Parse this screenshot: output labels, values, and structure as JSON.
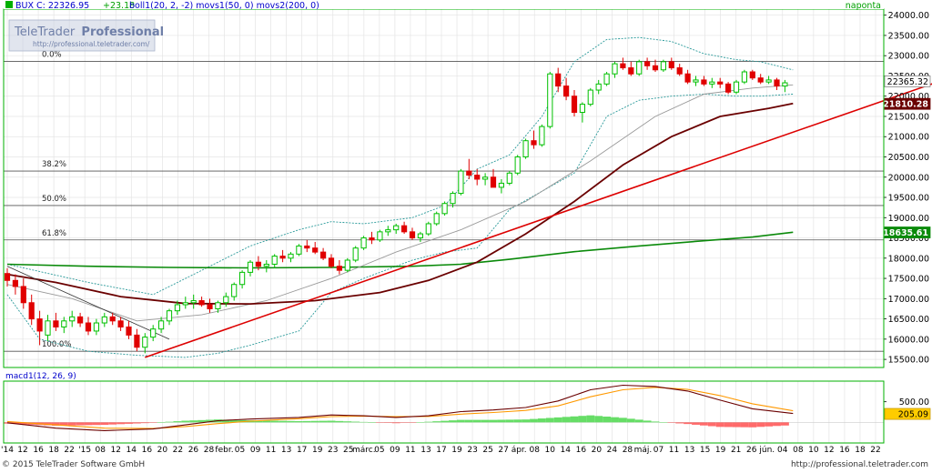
{
  "header": {
    "instrument": "BUX C: 22326.95",
    "change": "+23.18",
    "indicators": "boll1(20, 2, -2) movs1(50, 0) movs2(200, 0)",
    "period": "naponta"
  },
  "watermark": {
    "brand_part1": "TeleTrader",
    "brand_part2": "Professional",
    "url": "http://professional.teletrader.com/"
  },
  "macd_header": "macd1(12, 26, 9)",
  "footer": {
    "copyright": "© 2015 TeleTrader Software GmbH",
    "url": "http://professional.teletrader.com"
  },
  "colors": {
    "background": "#ffffff",
    "panel_border": "#00b000",
    "header_text": "#0000cc",
    "change_text": "#00a000",
    "grid": "#e4e4e4",
    "candle_up": "#00c000",
    "candle_down": "#e00000",
    "bollinger": "#2a9a9a",
    "ma50": "#999999",
    "ma200": "#6a0000",
    "green_ma": "#0a8a0a",
    "trendline": "#dd0000",
    "macd_line": "#6a0000",
    "signal_line": "#ff9900",
    "hist_pos": "#66dd66",
    "hist_neg": "#ff6a6a"
  },
  "chart_data": {
    "type": "line",
    "title": "BUX",
    "period": "naponta",
    "ylim": [
      15300,
      24150
    ],
    "y_ticks": [
      "24000.00",
      "23500.00",
      "23000.00",
      "22500.00",
      "22000.00",
      "21500.00",
      "21000.00",
      "20500.00",
      "20000.00",
      "19500.00",
      "19000.00",
      "18500.00",
      "18000.00",
      "17500.00",
      "17000.00",
      "16500.00",
      "16000.00",
      "15500.00"
    ],
    "x_ticks": [
      "'14",
      "12",
      "16",
      "18",
      "22",
      "'15",
      "08",
      "12",
      "14",
      "16",
      "20",
      "22",
      "26",
      "28",
      "febr.",
      "05",
      "09",
      "11",
      "13",
      "17",
      "19",
      "23",
      "25",
      "márc.",
      "05",
      "09",
      "11",
      "13",
      "17",
      "19",
      "23",
      "25",
      "27",
      "ápr.",
      "08",
      "10",
      "14",
      "16",
      "20",
      "24",
      "28",
      "máj.",
      "07",
      "11",
      "13",
      "15",
      "19",
      "21",
      "26",
      "jún.",
      "04",
      "08",
      "10",
      "12",
      "16",
      "18",
      "22"
    ],
    "fibonacci": [
      {
        "label": "0.0%",
        "value": 22860
      },
      {
        "label": "38.2%",
        "value": 20150
      },
      {
        "label": "50.0%",
        "value": 19300
      },
      {
        "label": "61.8%",
        "value": 18450
      },
      {
        "label": "100.0%",
        "value": 15700
      }
    ],
    "price_labels": [
      {
        "text": "22365.32",
        "value": 22365
      },
      {
        "text": "21810.28",
        "value": 21810
      },
      {
        "text": "18635.61",
        "value": 18635
      }
    ],
    "ohlc": [
      [
        17620,
        17750,
        17300,
        17450
      ],
      [
        17450,
        17600,
        17100,
        17300
      ],
      [
        17300,
        17500,
        16750,
        16900
      ],
      [
        16900,
        17100,
        16350,
        16500
      ],
      [
        16500,
        16700,
        15850,
        16200
      ],
      [
        16100,
        16600,
        15950,
        16450
      ],
      [
        16450,
        16650,
        16200,
        16300
      ],
      [
        16300,
        16550,
        16150,
        16450
      ],
      [
        16450,
        16700,
        16300,
        16550
      ],
      [
        16550,
        16650,
        16300,
        16400
      ],
      [
        16400,
        16550,
        16100,
        16200
      ],
      [
        16200,
        16500,
        16100,
        16400
      ],
      [
        16400,
        16650,
        16300,
        16550
      ],
      [
        16550,
        16650,
        16350,
        16450
      ],
      [
        16450,
        16550,
        16200,
        16300
      ],
      [
        16300,
        16450,
        16000,
        16100
      ],
      [
        16100,
        16250,
        15700,
        15800
      ],
      [
        15800,
        16150,
        15650,
        16050
      ],
      [
        16050,
        16350,
        15950,
        16250
      ],
      [
        16250,
        16550,
        16150,
        16450
      ],
      [
        16450,
        16750,
        16350,
        16700
      ],
      [
        16700,
        16950,
        16600,
        16850
      ],
      [
        16850,
        17050,
        16750,
        16900
      ],
      [
        16900,
        17100,
        16750,
        16950
      ],
      [
        16950,
        17050,
        16800,
        16850
      ],
      [
        16850,
        17000,
        16650,
        16750
      ],
      [
        16750,
        16950,
        16650,
        16900
      ],
      [
        16900,
        17150,
        16800,
        17050
      ],
      [
        17050,
        17400,
        16950,
        17350
      ],
      [
        17350,
        17700,
        17250,
        17650
      ],
      [
        17650,
        17950,
        17550,
        17900
      ],
      [
        17900,
        18050,
        17700,
        17800
      ],
      [
        17800,
        17950,
        17650,
        17850
      ],
      [
        17850,
        18100,
        17750,
        18050
      ],
      [
        18050,
        18200,
        17900,
        18000
      ],
      [
        18000,
        18150,
        17900,
        18100
      ],
      [
        18100,
        18350,
        18050,
        18300
      ],
      [
        18300,
        18450,
        18150,
        18250
      ],
      [
        18250,
        18400,
        18100,
        18150
      ],
      [
        18150,
        18250,
        17950,
        18000
      ],
      [
        18000,
        18100,
        17750,
        17800
      ],
      [
        17800,
        17950,
        17600,
        17700
      ],
      [
        17700,
        18000,
        17650,
        17950
      ],
      [
        17950,
        18300,
        17900,
        18250
      ],
      [
        18250,
        18550,
        18200,
        18500
      ],
      [
        18500,
        18650,
        18350,
        18450
      ],
      [
        18450,
        18700,
        18400,
        18650
      ],
      [
        18650,
        18800,
        18550,
        18700
      ],
      [
        18700,
        18850,
        18600,
        18800
      ],
      [
        18800,
        18900,
        18600,
        18650
      ],
      [
        18650,
        18750,
        18450,
        18500
      ],
      [
        18500,
        18650,
        18400,
        18600
      ],
      [
        18600,
        18900,
        18550,
        18850
      ],
      [
        18850,
        19150,
        18800,
        19100
      ],
      [
        19100,
        19400,
        19050,
        19350
      ],
      [
        19350,
        19650,
        19250,
        19600
      ],
      [
        19600,
        20200,
        19550,
        20150
      ],
      [
        20150,
        20450,
        19950,
        20050
      ],
      [
        20050,
        20200,
        19800,
        19950
      ],
      [
        19950,
        20100,
        19800,
        20000
      ],
      [
        20000,
        20200,
        19850,
        19750
      ],
      [
        19750,
        19950,
        19600,
        19850
      ],
      [
        19850,
        20150,
        19800,
        20100
      ],
      [
        20100,
        20550,
        20050,
        20500
      ],
      [
        20500,
        20950,
        20450,
        20900
      ],
      [
        20900,
        21150,
        20700,
        20800
      ],
      [
        20800,
        21300,
        20750,
        21250
      ],
      [
        21250,
        22600,
        21200,
        22550
      ],
      [
        22550,
        22700,
        22100,
        22250
      ],
      [
        22250,
        22450,
        21900,
        22000
      ],
      [
        22000,
        22150,
        21500,
        21600
      ],
      [
        21600,
        21850,
        21350,
        21800
      ],
      [
        21800,
        22200,
        21750,
        22150
      ],
      [
        22150,
        22400,
        22050,
        22300
      ],
      [
        22300,
        22600,
        22250,
        22550
      ],
      [
        22550,
        22850,
        22450,
        22800
      ],
      [
        22800,
        22950,
        22650,
        22700
      ],
      [
        22700,
        22850,
        22500,
        22550
      ],
      [
        22550,
        22900,
        22500,
        22850
      ],
      [
        22850,
        22950,
        22650,
        22750
      ],
      [
        22750,
        22900,
        22600,
        22650
      ],
      [
        22650,
        22900,
        22600,
        22850
      ],
      [
        22850,
        22950,
        22650,
        22700
      ],
      [
        22700,
        22800,
        22500,
        22550
      ],
      [
        22550,
        22650,
        22300,
        22350
      ],
      [
        22350,
        22500,
        22250,
        22400
      ],
      [
        22400,
        22500,
        22250,
        22300
      ],
      [
        22300,
        22450,
        22200,
        22350
      ],
      [
        22350,
        22450,
        22200,
        22300
      ],
      [
        22300,
        22350,
        22050,
        22100
      ],
      [
        22100,
        22400,
        22050,
        22350
      ],
      [
        22350,
        22650,
        22300,
        22600
      ],
      [
        22600,
        22650,
        22400,
        22450
      ],
      [
        22450,
        22550,
        22300,
        22350
      ],
      [
        22350,
        22500,
        22300,
        22400
      ],
      [
        22400,
        22450,
        22150,
        22250
      ],
      [
        22250,
        22400,
        22100,
        22330
      ]
    ],
    "bollinger_upper": [
      [
        0,
        17850
      ],
      [
        10,
        17400
      ],
      [
        18,
        17100
      ],
      [
        24,
        17700
      ],
      [
        30,
        18300
      ],
      [
        36,
        18700
      ],
      [
        40,
        18900
      ],
      [
        44,
        18850
      ],
      [
        50,
        19000
      ],
      [
        54,
        19300
      ],
      [
        58,
        20200
      ],
      [
        62,
        20550
      ],
      [
        66,
        21500
      ],
      [
        70,
        22850
      ],
      [
        74,
        23400
      ],
      [
        78,
        23450
      ],
      [
        82,
        23350
      ],
      [
        86,
        23050
      ],
      [
        90,
        22900
      ],
      [
        93,
        22850
      ],
      [
        97,
        22650
      ]
    ],
    "bollinger_lower": [
      [
        0,
        17100
      ],
      [
        4,
        16000
      ],
      [
        10,
        15700
      ],
      [
        16,
        15600
      ],
      [
        22,
        15550
      ],
      [
        26,
        15650
      ],
      [
        30,
        15850
      ],
      [
        36,
        16200
      ],
      [
        40,
        17150
      ],
      [
        44,
        17500
      ],
      [
        50,
        17950
      ],
      [
        54,
        18150
      ],
      [
        58,
        18250
      ],
      [
        62,
        19200
      ],
      [
        66,
        19650
      ],
      [
        70,
        20100
      ],
      [
        74,
        21500
      ],
      [
        78,
        21900
      ],
      [
        82,
        22000
      ],
      [
        86,
        22050
      ],
      [
        90,
        22000
      ],
      [
        93,
        22000
      ],
      [
        97,
        22050
      ]
    ],
    "ma50": [
      [
        0,
        17350
      ],
      [
        8,
        17000
      ],
      [
        16,
        16450
      ],
      [
        24,
        16600
      ],
      [
        32,
        16950
      ],
      [
        40,
        17500
      ],
      [
        48,
        18150
      ],
      [
        56,
        18700
      ],
      [
        64,
        19400
      ],
      [
        72,
        20400
      ],
      [
        80,
        21500
      ],
      [
        86,
        22050
      ],
      [
        92,
        22200
      ],
      [
        97,
        22280
      ]
    ],
    "ma200": [
      [
        0,
        17600
      ],
      [
        6,
        17400
      ],
      [
        14,
        17050
      ],
      [
        22,
        16880
      ],
      [
        30,
        16870
      ],
      [
        38,
        16950
      ],
      [
        46,
        17150
      ],
      [
        52,
        17450
      ],
      [
        58,
        17900
      ],
      [
        64,
        18600
      ],
      [
        70,
        19400
      ],
      [
        76,
        20300
      ],
      [
        82,
        21000
      ],
      [
        88,
        21500
      ],
      [
        94,
        21700
      ],
      [
        97,
        21820
      ]
    ],
    "green_ma": [
      [
        0,
        17850
      ],
      [
        10,
        17800
      ],
      [
        20,
        17770
      ],
      [
        30,
        17760
      ],
      [
        40,
        17770
      ],
      [
        50,
        17800
      ],
      [
        56,
        17850
      ],
      [
        62,
        17970
      ],
      [
        70,
        18160
      ],
      [
        78,
        18300
      ],
      [
        86,
        18430
      ],
      [
        92,
        18520
      ],
      [
        97,
        18640
      ]
    ],
    "trendline": [
      [
        17,
        15550
      ],
      [
        117,
        22500
      ]
    ],
    "old_trendline": [
      [
        0,
        17800
      ],
      [
        20,
        16000
      ]
    ],
    "macd": {
      "ylim": [
        -500,
        1000
      ],
      "tick_label": "500.00",
      "tick_value": 500,
      "last_label": "205.09",
      "last_value": 205,
      "macd_line": [
        [
          0,
          -10
        ],
        [
          6,
          -140
        ],
        [
          12,
          -200
        ],
        [
          18,
          -160
        ],
        [
          22,
          -60
        ],
        [
          26,
          40
        ],
        [
          30,
          80
        ],
        [
          36,
          120
        ],
        [
          40,
          180
        ],
        [
          44,
          160
        ],
        [
          48,
          120
        ],
        [
          52,
          160
        ],
        [
          56,
          260
        ],
        [
          60,
          300
        ],
        [
          64,
          360
        ],
        [
          68,
          520
        ],
        [
          72,
          790
        ],
        [
          76,
          900
        ],
        [
          80,
          870
        ],
        [
          84,
          760
        ],
        [
          88,
          540
        ],
        [
          92,
          330
        ],
        [
          97,
          215
        ]
      ],
      "signal_line": [
        [
          0,
          20
        ],
        [
          6,
          -60
        ],
        [
          12,
          -140
        ],
        [
          18,
          -150
        ],
        [
          22,
          -100
        ],
        [
          26,
          -30
        ],
        [
          30,
          30
        ],
        [
          36,
          90
        ],
        [
          40,
          140
        ],
        [
          44,
          150
        ],
        [
          48,
          140
        ],
        [
          52,
          145
        ],
        [
          56,
          200
        ],
        [
          60,
          240
        ],
        [
          64,
          290
        ],
        [
          68,
          400
        ],
        [
          72,
          620
        ],
        [
          76,
          790
        ],
        [
          80,
          850
        ],
        [
          84,
          800
        ],
        [
          88,
          650
        ],
        [
          92,
          450
        ],
        [
          97,
          280
        ]
      ]
    }
  }
}
